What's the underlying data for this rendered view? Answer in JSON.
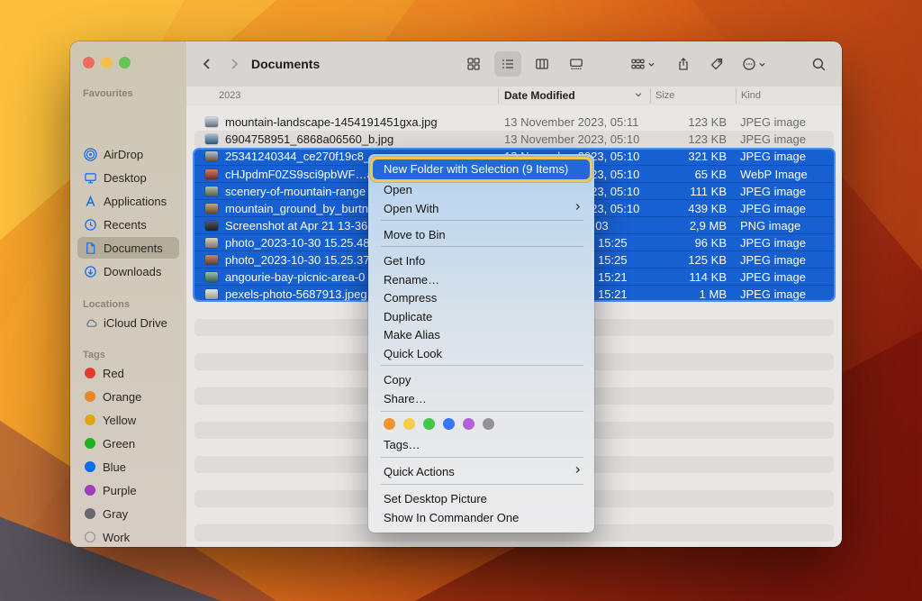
{
  "window": {
    "title": "Documents"
  },
  "sidebar": {
    "sections": [
      {
        "label": "Favourites",
        "items": [
          {
            "label": "AirDrop"
          },
          {
            "label": "Desktop"
          },
          {
            "label": "Applications"
          },
          {
            "label": "Recents"
          },
          {
            "label": "Documents"
          },
          {
            "label": "Downloads"
          }
        ]
      },
      {
        "label": "Locations",
        "items": [
          {
            "label": "iCloud Drive"
          }
        ]
      },
      {
        "label": "Tags",
        "items": [
          {
            "label": "Red",
            "color": "#e23b2e"
          },
          {
            "label": "Orange",
            "color": "#e8862c"
          },
          {
            "label": "Yellow",
            "color": "#e0a611"
          },
          {
            "label": "Green",
            "color": "#1db320"
          },
          {
            "label": "Blue",
            "color": "#0c6bf0"
          },
          {
            "label": "Purple",
            "color": "#9f3dbd"
          },
          {
            "label": "Gray",
            "color": "#68686d"
          },
          {
            "label": "Work",
            "color": ""
          }
        ]
      }
    ]
  },
  "list": {
    "group_label": "2023",
    "columns": {
      "date": "Date Modified",
      "size": "Size",
      "kind": "Kind"
    },
    "rows": [
      {
        "name": "mountain-landscape-1454191451gxa.jpg",
        "date": "13 November 2023, 05:11",
        "size": "123 KB",
        "kind": "JPEG image",
        "thumb": [
          "#cfd8df",
          "#5f6e7d"
        ]
      },
      {
        "name": "6904758951_6868a06560_b.jpg",
        "date": "13 November 2023, 05:10",
        "size": "123 KB",
        "kind": "JPEG image",
        "thumb": [
          "#9fc0dd",
          "#33536e"
        ]
      },
      {
        "name": "25341240344_ce270f19c8_",
        "date": "13 November 2023, 05:10",
        "size": "321 KB",
        "kind": "JPEG image",
        "thumb": [
          "#b9c2cb",
          "#5a5247"
        ]
      },
      {
        "name": "cHJpdmF0ZS9sci9pbWF…a",
        "date": "13 November 2023, 05:10",
        "size": "65 KB",
        "kind": "WebP Image",
        "thumb": [
          "#d77d5f",
          "#6e2a22"
        ]
      },
      {
        "name": "scenery-of-mountain-range",
        "date": "13 November 2023, 05:10",
        "size": "111 KB",
        "kind": "JPEG image",
        "thumb": [
          "#b4bfa6",
          "#4f5c44"
        ]
      },
      {
        "name": "mountain_ground_by_burtn",
        "date": "13 November 2023, 05:10",
        "size": "439 KB",
        "kind": "JPEG image",
        "thumb": [
          "#c2a87e",
          "#5e4a2e"
        ]
      },
      {
        "name": "Screenshot at Apr 21 13-36-",
        "date": "21 April 2023, 16:03",
        "size": "2,9 MB",
        "kind": "PNG image",
        "thumb": [
          "#54575e",
          "#1e2024"
        ]
      },
      {
        "name": "photo_2023-10-30 15.25.48",
        "date": "30 October 2023, 15:25",
        "size": "96 KB",
        "kind": "JPEG image",
        "thumb": [
          "#d9cfbf",
          "#7e7468"
        ]
      },
      {
        "name": "photo_2023-10-30 15.25.37",
        "date": "30 October 2023, 15:25",
        "size": "125 KB",
        "kind": "JPEG image",
        "thumb": [
          "#c08a68",
          "#5f3a26"
        ]
      },
      {
        "name": "angourie-bay-picnic-area-0",
        "date": "30 October 2023, 15:21",
        "size": "114 KB",
        "kind": "JPEG image",
        "thumb": [
          "#9cc0ae",
          "#2f5e4c"
        ]
      },
      {
        "name": "pexels-photo-5687913.jpeg",
        "date": "30 October 2023, 15:21",
        "size": "1 MB",
        "kind": "JPEG image",
        "thumb": [
          "#e3e2e0",
          "#9a9a96"
        ]
      }
    ]
  },
  "menu": {
    "new_folder": "New Folder with Selection (9 Items)",
    "open": "Open",
    "open_with": "Open With",
    "move_to_bin": "Move to Bin",
    "get_info": "Get Info",
    "rename": "Rename…",
    "compress": "Compress",
    "duplicate": "Duplicate",
    "make_alias": "Make Alias",
    "quick_look": "Quick Look",
    "copy": "Copy",
    "share": "Share…",
    "tags": "Tags…",
    "quick_actions": "Quick Actions",
    "set_desktop_picture": "Set Desktop Picture",
    "show_in_commander_one": "Show In Commander One",
    "tag_dots": [
      "#f0942e",
      "#f3ce49",
      "#43c84c",
      "#3378f6",
      "#af62d9",
      "#929297"
    ]
  },
  "colors": {
    "selection": "#1760d2",
    "menu_highlight": "#2468d9",
    "focus_ring": "#f3c94b"
  }
}
